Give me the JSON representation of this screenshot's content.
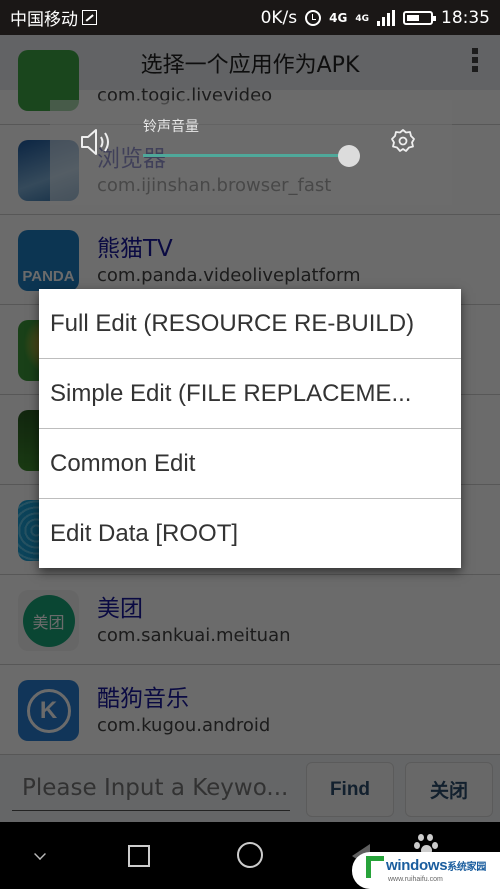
{
  "status_bar": {
    "carrier": "中国移动",
    "speed": "0K/s",
    "network_1": "4G",
    "network_2": "4G",
    "time": "18:35",
    "battery_level": 0.55
  },
  "title_bar": {
    "title": "选择一个应用作为APK"
  },
  "app_list": {
    "items": [
      {
        "name": "",
        "package": "com.togic.livevideo",
        "icon": "togic-icon",
        "icon_color": "#3fa845"
      },
      {
        "name": "浏览器",
        "package": "com.ijinshan.browser_fast",
        "icon": "browser-icon",
        "icon_color": "#2b6fb5"
      },
      {
        "name": "熊猫TV",
        "package": "com.panda.videoliveplatform",
        "icon": "panda-icon",
        "icon_color": "#1e7fc4",
        "icon_text": "PANDA"
      },
      {
        "name": "",
        "package": "",
        "icon": "game-icon",
        "icon_color": "#3d9a3a"
      },
      {
        "name": "",
        "package": "",
        "icon": "penguin-icon",
        "icon_color": "#3e8b2e"
      },
      {
        "name": "",
        "package": "",
        "icon": "wave-icon",
        "icon_color": "#1b9fd7"
      },
      {
        "name": "美团",
        "package": "com.sankuai.meituan",
        "icon": "meituan-icon",
        "icon_color": "#1aa87a",
        "icon_text": "美团"
      },
      {
        "name": "酷狗音乐",
        "package": "com.kugou.android",
        "icon": "kugou-icon",
        "icon_color": "#2a7fd4",
        "icon_text": "K"
      }
    ]
  },
  "volume_panel": {
    "label": "铃声音量",
    "level": 1.0,
    "accent_color": "#4fa89a"
  },
  "popup_menu": {
    "items": [
      {
        "label": "Full Edit (RESOURCE RE-BUILD)"
      },
      {
        "label": "Simple Edit (FILE REPLACEME..."
      },
      {
        "label": "Common Edit"
      },
      {
        "label": "Edit Data [ROOT]"
      }
    ]
  },
  "search_bar": {
    "placeholder": "Please Input a Keywo...",
    "value": "",
    "find_label": "Find",
    "close_label": "关闭"
  },
  "watermark": {
    "brand": "windows",
    "brand_cn": "系统家园",
    "url": "www.ruihaifu.com"
  }
}
